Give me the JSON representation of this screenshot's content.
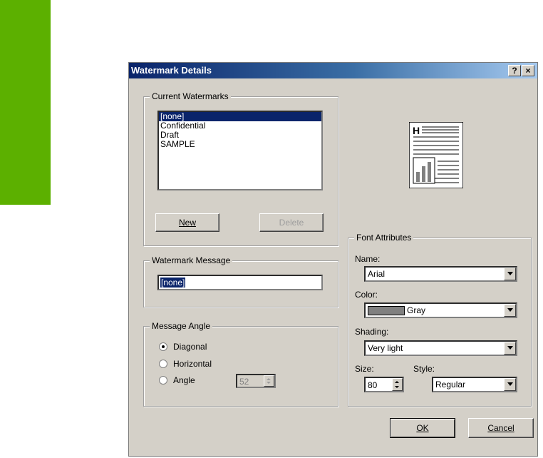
{
  "dialog": {
    "title": "Watermark Details",
    "help_button": "?",
    "close_button": "×"
  },
  "current_watermarks": {
    "title": "Current Watermarks",
    "items": [
      "[none]",
      "Confidential",
      "Draft",
      "SAMPLE"
    ],
    "selected_index": 0,
    "new_label": "New",
    "delete_label": "Delete"
  },
  "watermark_message": {
    "title": "Watermark Message",
    "value": "[none]"
  },
  "message_angle": {
    "title": "Message Angle",
    "options": [
      "Diagonal",
      "Horizontal",
      "Angle"
    ],
    "selected": "Diagonal",
    "angle_value": "52"
  },
  "font_attributes": {
    "title": "Font Attributes",
    "name_label": "Name:",
    "name_value": "Arial",
    "color_label": "Color:",
    "color_value": "Gray",
    "color_swatch": "#808080",
    "shading_label": "Shading:",
    "shading_value": "Very light",
    "size_label": "Size:",
    "size_value": "80",
    "style_label": "Style:",
    "style_value": "Regular"
  },
  "buttons": {
    "ok": "OK",
    "cancel": "Cancel"
  },
  "preview": {
    "heading_letter": "H"
  },
  "colors": {
    "accent_green": "#5cb000",
    "titlebar": "#0a246a",
    "dialog_bg": "#d4d0c8"
  }
}
